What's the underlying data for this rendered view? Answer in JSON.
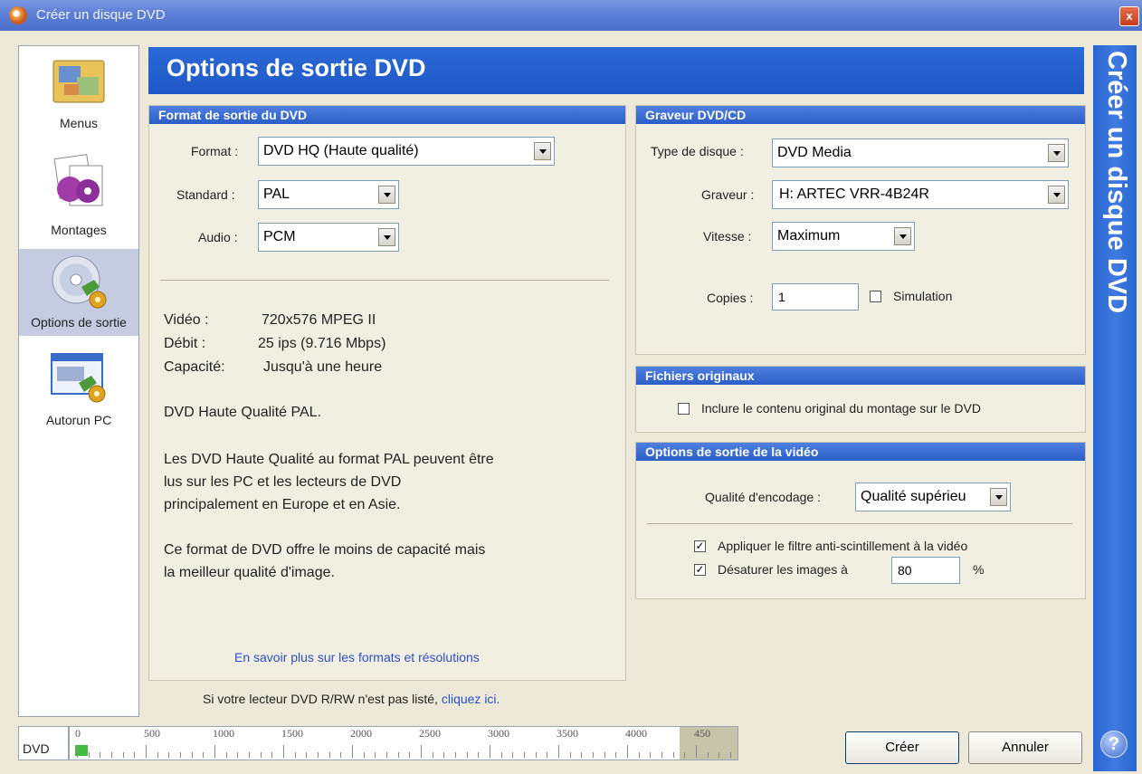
{
  "window": {
    "title": "Créer un disque DVD",
    "close_label": "x"
  },
  "sidebar": {
    "items": [
      {
        "label": "Menus",
        "icon": "menus-icon"
      },
      {
        "label": "Montages",
        "icon": "montages-icon"
      },
      {
        "label": "Options de sortie",
        "icon": "output-options-icon"
      },
      {
        "label": "Autorun PC",
        "icon": "autorun-icon"
      }
    ]
  },
  "banner": {
    "title": "Options de sortie DVD"
  },
  "side_title": "Créer un disque DVD",
  "format_panel": {
    "header": "Format de sortie du DVD",
    "format_label": "Format :",
    "format_value": "DVD HQ (Haute qualité)",
    "standard_label": "Standard :",
    "standard_value": "PAL",
    "audio_label": "Audio :",
    "audio_value": "PCM",
    "video_label": "Vidéo :",
    "video_value": "720x576 MPEG II",
    "rate_label": "Débit :",
    "rate_value": "25 ips (9.716 Mbps)",
    "capacity_label": "Capacité:",
    "capacity_value": "Jusqu'à une heure",
    "desc1": "DVD Haute Qualité PAL.",
    "desc2_line1": "Les DVD Haute Qualité au format PAL peuvent être",
    "desc2_line2": "lus sur les PC et les lecteurs de DVD",
    "desc2_line3": "principalement en Europe et en Asie.",
    "desc3_line1": "Ce format de DVD offre le moins de capacité mais",
    "desc3_line2": "la meilleur qualité d'image.",
    "learn_more": "En savoir plus sur les formats et résolutions"
  },
  "footer_note": {
    "text": "Si votre lecteur DVD R/RW n'est pas listé,",
    "link": "cliquez ici."
  },
  "burner_panel": {
    "header": "Graveur DVD/CD",
    "disc_type_label": "Type de disque :",
    "disc_type_value": "DVD Media",
    "burner_label": "Graveur :",
    "burner_value": "H: ARTEC VRR-4B24R",
    "speed_label": "Vitesse :",
    "speed_value": "Maximum",
    "copies_label": "Copies :",
    "copies_value": "1",
    "simulation_label": "Simulation",
    "simulation_checked": false
  },
  "originals_panel": {
    "header": "Fichiers originaux",
    "include_label": "Inclure le contenu original du montage sur le DVD",
    "include_checked": false
  },
  "video_panel": {
    "header": "Options de sortie de la vidéo",
    "quality_label": "Qualité d'encodage :",
    "quality_value": "Qualité supérieu",
    "antiflicker_label": "Appliquer le filtre anti-scintillement à la vidéo",
    "antiflicker_checked": true,
    "desaturate_label": "Désaturer les images à",
    "desaturate_value": "80",
    "desaturate_unit": "%",
    "desaturate_checked": true
  },
  "capacity_bar": {
    "label": "DVD",
    "ticks": [
      "0",
      "500",
      "1000",
      "1500",
      "2000",
      "2500",
      "3000",
      "3500",
      "4000",
      "450"
    ],
    "used_fraction": 0.02,
    "used_color": "#3fbf3f"
  },
  "buttons": {
    "create": "Créer",
    "cancel": "Annuler"
  },
  "colors": {
    "accent": "#1e57c7",
    "titlebar": "#5c7fd8"
  }
}
